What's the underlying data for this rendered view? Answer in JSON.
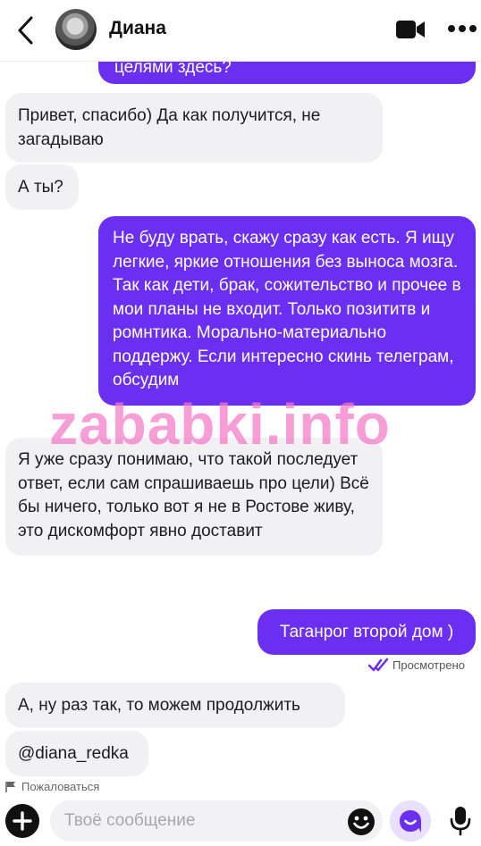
{
  "header": {
    "contact_name": "Диана",
    "back_icon": "chevron-left-icon",
    "video_icon": "video-camera-icon",
    "more_icon": "more-horizontal-icon"
  },
  "messages": [
    {
      "dir": "out",
      "text": "целями здесь?",
      "partial": true
    },
    {
      "dir": "in",
      "text": "Привет, спасибо) Да как получится, не загадываю"
    },
    {
      "dir": "in",
      "text": "А ты?"
    },
    {
      "dir": "out",
      "text": "Не буду врать, скажу сразу как есть. Я ищу легкие, яркие отношения без выноса мозга. Так как дети, брак, сожительство и прочее в мои планы не входит. Только позититв и ромнтика. Морально-материально поддержу. Если интересно скинь телеграм, обсудим"
    },
    {
      "dir": "in",
      "text": "Я уже сразу понимаю, что такой последует ответ, если сам спрашиваешь про цели) Всё бы ничего, только вот я не в Ростове живу, это дискомфорт явно доставит"
    },
    {
      "dir": "out",
      "text": "Таганрог второй дом )"
    },
    {
      "dir": "in",
      "text": "А, ну раз так, то можем продолжить"
    },
    {
      "dir": "in",
      "text": "@diana_redka"
    }
  ],
  "seen_status": "Просмотрено",
  "report_label": "Пожаловаться",
  "watermark": "zababki.info",
  "composer": {
    "placeholder": "Твоё сообщение",
    "add_icon": "plus-circle-icon",
    "emoji_icon": "emoji-icon",
    "assistant_icon": "assistant-icon",
    "mic_icon": "microphone-icon"
  },
  "colors": {
    "outgoing_bubble": "#6a2ff0",
    "incoming_bubble": "#f1f1f3",
    "accent": "#6a2ff0",
    "watermark": "#f478c8"
  }
}
